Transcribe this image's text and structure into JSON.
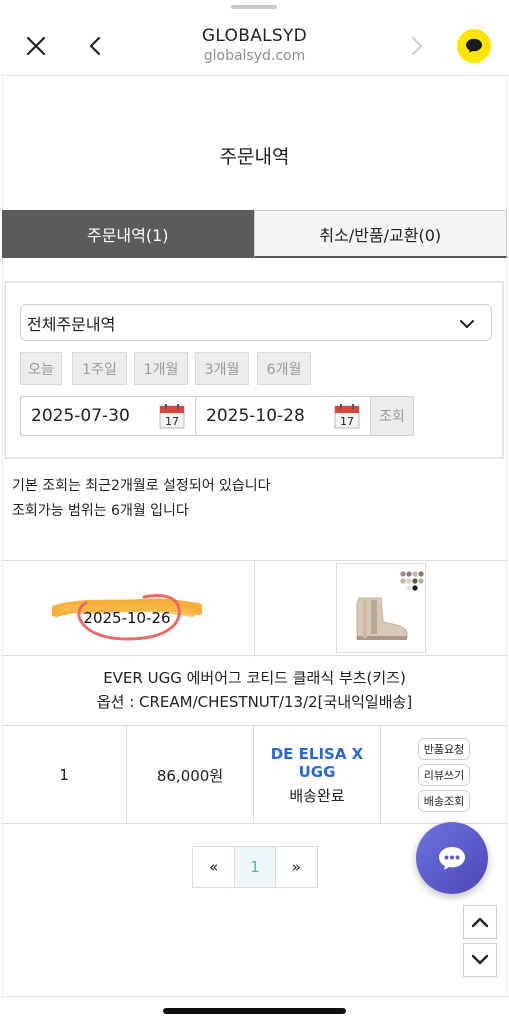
{
  "browser": {
    "site_title": "GLOBALSYD",
    "site_url": "globalsyd.com",
    "icons": [
      "close-icon",
      "back-icon",
      "forward-icon",
      "kakao-talk-icon"
    ]
  },
  "page": {
    "title": "주문내역"
  },
  "tabs": [
    {
      "label": "주문내역(1)",
      "active": true
    },
    {
      "label": "취소/반품/교환(0)",
      "active": false
    }
  ],
  "filter": {
    "select_value": "전체주문내역",
    "periods": [
      "오늘",
      "1주일",
      "1개월",
      "3개월",
      "6개월"
    ],
    "date_from": "2025-07-30",
    "date_to": "2025-10-28",
    "calendar_day": "17",
    "search_label": "조회"
  },
  "notice": {
    "line1": "기본 조회는 최근2개월로 설정되어 있습니다",
    "line2": "조회가능 범위는 6개월 입니다"
  },
  "order": {
    "date": "2025-10-26",
    "product_name": "EVER UGG 에버어그 코티드 클래식 부츠(키즈)",
    "option": "옵션 : CREAM/CHESTNUT/13/2[국내익일배송]",
    "quantity": "1",
    "price": "86,000원",
    "brand": "DE ELISA X UGG",
    "status": "배송완료",
    "actions": [
      "반품요청",
      "리뷰쓰기",
      "배송조회"
    ]
  },
  "pagination": {
    "prev": "«",
    "current": "1",
    "next": "»"
  },
  "colors": {
    "active_tab": "#5b5b5b",
    "brand_text": "#2a67d3",
    "kakao": "#fee500",
    "chat_fab": "#5a5ccc",
    "pager_current": "#4fb3c8",
    "annotation_circle": "#e86b6b",
    "highlight": "#f5a623"
  }
}
